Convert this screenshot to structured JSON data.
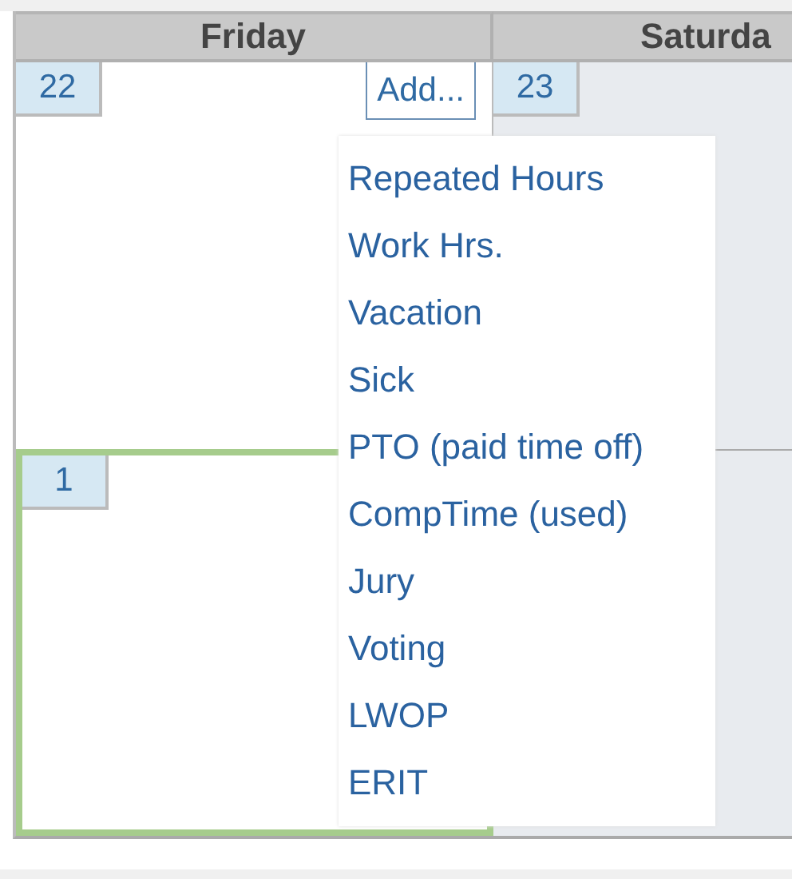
{
  "header": {
    "days": [
      "Friday",
      "Saturda"
    ]
  },
  "weeks": [
    {
      "cells": [
        {
          "day": "22",
          "today": false,
          "add_button": "Add..."
        },
        {
          "day": "23",
          "today": false
        }
      ]
    },
    {
      "cells": [
        {
          "day": "1",
          "today": true
        },
        {
          "today": false
        }
      ]
    }
  ],
  "menu": {
    "items": [
      "Repeated Hours",
      "Work Hrs.",
      "Vacation",
      "Sick",
      "PTO (paid time off)",
      "CompTime (used)",
      "Jury",
      "Voting",
      "LWOP",
      "ERIT"
    ]
  }
}
